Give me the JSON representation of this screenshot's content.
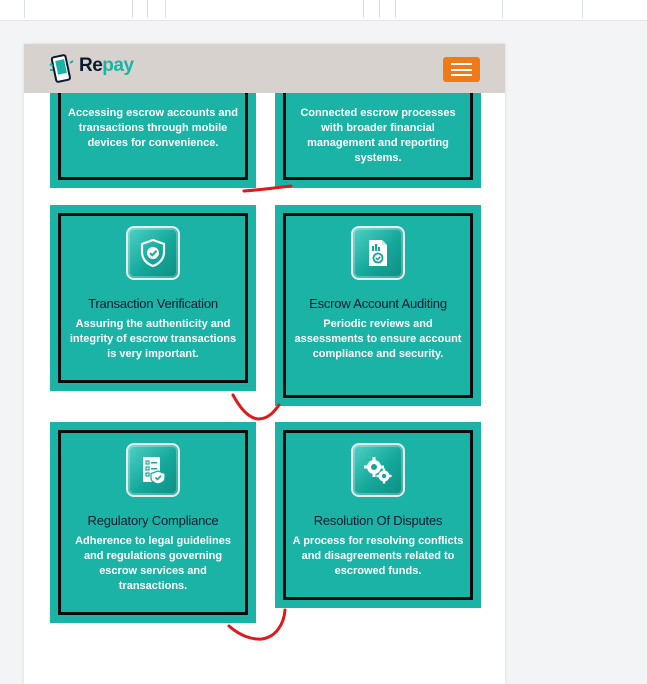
{
  "brand": {
    "name_part1": "Re",
    "name_part2": "pay"
  },
  "colors": {
    "card": "#1ab3a6",
    "accent": "#f07b16",
    "navbar": "#d7d2cd",
    "annotation": "#e0191c"
  },
  "navbar": {
    "menu_icon": "hamburger-menu-icon"
  },
  "cards": [
    {
      "title": "",
      "description": "Accessing escrow accounts and transactions through mobile devices for convenience."
    },
    {
      "title": "",
      "description": "Connected escrow processes with broader financial management and reporting systems."
    },
    {
      "title": "Transaction Verification",
      "description": "Assuring the authenticity and integrity of escrow transactions is very important.",
      "icon": "shield-check-icon"
    },
    {
      "title": "Escrow Account Auditing",
      "description": "Periodic reviews and assessments to ensure account compliance and security.",
      "icon": "audit-document-icon"
    },
    {
      "title": "Regulatory Compliance",
      "description": "Adherence to legal guidelines and regulations governing escrow services and transactions.",
      "icon": "compliance-checklist-icon"
    },
    {
      "title": "Resolution Of Disputes",
      "description": "A process for resolving conflicts and disagreements related to escrowed funds.",
      "icon": "gears-icon"
    }
  ]
}
